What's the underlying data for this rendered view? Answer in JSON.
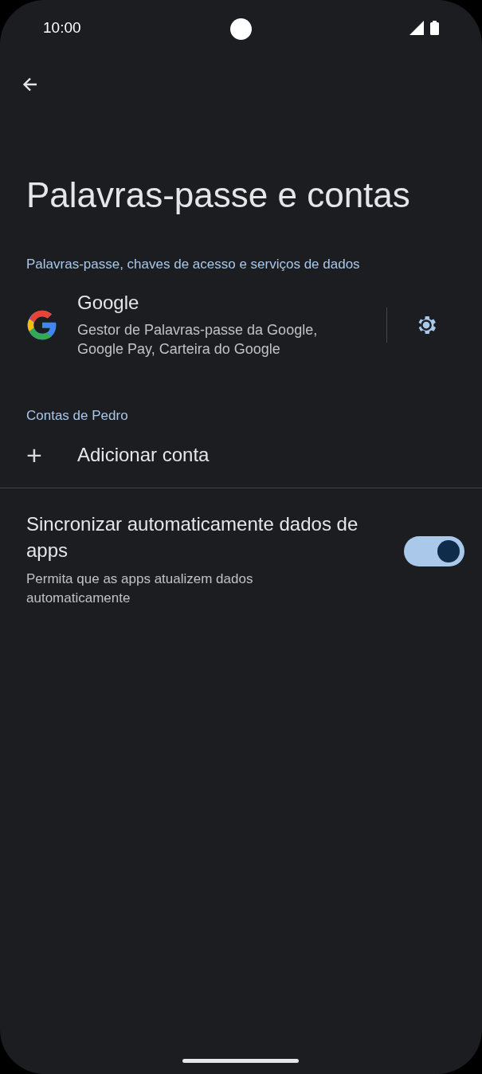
{
  "status_bar": {
    "time": "10:00"
  },
  "title": "Palavras-passe e contas",
  "services_header": "Palavras-passe, chaves de acesso e serviços de dados",
  "service": {
    "name": "Google",
    "description": "Gestor de Palavras-passe da Google, Google Pay, Carteira do Google"
  },
  "accounts_header": "Contas de Pedro",
  "add_account": {
    "icon": "+",
    "label": "Adicionar conta"
  },
  "auto_sync": {
    "title": "Sincronizar automaticamente dados de apps",
    "subtitle": "Permita que as apps atualizem dados automaticamente",
    "on": true
  }
}
